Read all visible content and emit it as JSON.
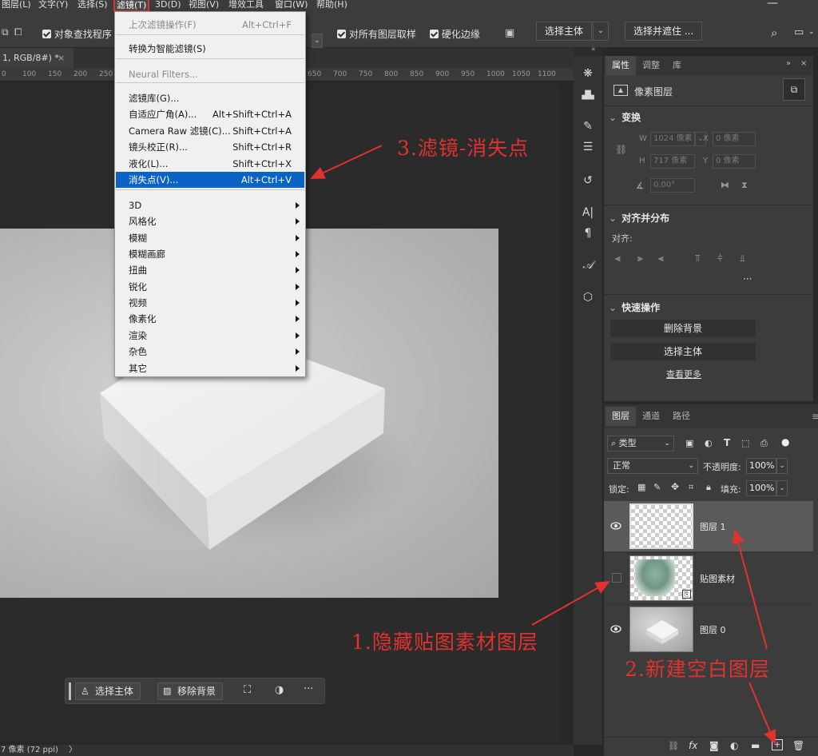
{
  "menubar": {
    "items": [
      "图层(L)",
      "文字(Y)",
      "选择(S)",
      "滤镜(T)",
      "3D(D)",
      "视图(V)",
      "增效工具",
      "窗口(W)",
      "帮助(H)"
    ]
  },
  "options_bar": {
    "object_finder_label": "对象查找程序",
    "sample_all_label": "对所有图层取样",
    "harden_edges_label": "硬化边缘",
    "select_subject_btn": "选择主体",
    "select_and_mask_btn": "选择并遮住 ..."
  },
  "document": {
    "tab_label": "1, RGB/8#) *",
    "tab_close": "×",
    "status_text": "7 像素 (72 ppi)",
    "status_chevron": "〉"
  },
  "ruler": {
    "ticks": [
      "0",
      "100",
      "150",
      "200",
      "250",
      "650",
      "700",
      "750",
      "800",
      "850",
      "900",
      "950",
      "1000",
      "1050",
      "1100"
    ]
  },
  "filter_menu": {
    "items": [
      {
        "label": "上次滤镜操作(F)",
        "shortcut": "Alt+Ctrl+F",
        "disabled": true
      },
      {
        "label": "转换为智能滤镜(S)",
        "shortcut": ""
      },
      {
        "label": "Neural Filters...",
        "shortcut": "",
        "disabled": true
      },
      {
        "label": "滤镜库(G)...",
        "shortcut": ""
      },
      {
        "label": "自适应广角(A)...",
        "shortcut": "Alt+Shift+Ctrl+A"
      },
      {
        "label": "Camera Raw 滤镜(C)...",
        "shortcut": "Shift+Ctrl+A"
      },
      {
        "label": "镜头校正(R)...",
        "shortcut": "Shift+Ctrl+R"
      },
      {
        "label": "液化(L)...",
        "shortcut": "Shift+Ctrl+X"
      },
      {
        "label": "消失点(V)...",
        "shortcut": "Alt+Ctrl+V",
        "highlighted": true
      },
      {
        "label": "3D",
        "submenu": true
      },
      {
        "label": "风格化",
        "submenu": true
      },
      {
        "label": "模糊",
        "submenu": true
      },
      {
        "label": "模糊画廊",
        "submenu": true
      },
      {
        "label": "扭曲",
        "submenu": true
      },
      {
        "label": "锐化",
        "submenu": true
      },
      {
        "label": "视频",
        "submenu": true
      },
      {
        "label": "像素化",
        "submenu": true
      },
      {
        "label": "渲染",
        "submenu": true
      },
      {
        "label": "杂色",
        "submenu": true
      },
      {
        "label": "其它",
        "submenu": true
      }
    ]
  },
  "taskbar": {
    "select_subject": "选择主体",
    "remove_bg": "移除背景",
    "more": "···"
  },
  "properties_panel": {
    "tabs": [
      "属性",
      "调整",
      "库"
    ],
    "layer_kind": "像素图层",
    "transform_title": "变换",
    "w_label": "W",
    "w_value": "1024 像素",
    "h_label": "H",
    "h_value": "717 像素",
    "x_label": "X",
    "x_value": "0 像素",
    "y_label": "Y",
    "y_value": "0 像素",
    "angle_value": "0.00°",
    "align_title": "对齐并分布",
    "align_label": "对齐:",
    "more_dots": "···",
    "quick_actions_title": "快速操作",
    "remove_bg_btn": "删除背景",
    "select_subject_btn": "选择主体",
    "see_more": "查看更多"
  },
  "layers_panel": {
    "tabs": [
      "图层",
      "通道",
      "路径"
    ],
    "filter_kind": "类型",
    "blend_mode": "正常",
    "opacity_label": "不透明度:",
    "opacity_value": "100%",
    "lock_label": "锁定:",
    "fill_label": "填充:",
    "fill_value": "100%",
    "layers": [
      {
        "name": "图层 1",
        "visible": true,
        "selected": true
      },
      {
        "name": "贴图素材",
        "visible": false,
        "selected": false
      },
      {
        "name": "图层 0",
        "visible": true,
        "selected": false
      }
    ]
  },
  "annotations": {
    "step1": "1.隐藏贴图素材图层",
    "step2": "2.新建空白图层",
    "step3": "3.滤镜-消失点"
  },
  "colors": {
    "annotation_red": "#e0322f",
    "menu_highlight": "#0a64c8"
  }
}
